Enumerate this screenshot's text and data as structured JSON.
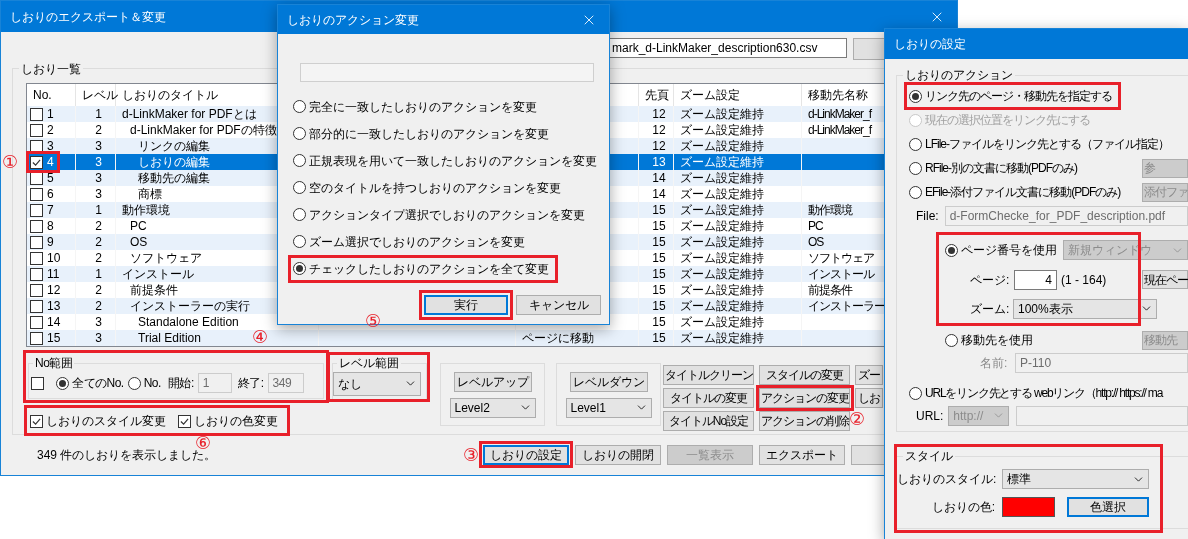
{
  "main_window": {
    "title": "しおりのエクスポート＆変更",
    "file_field": "mark_d-LinkMaker_description630.csv",
    "bookmark_list": {
      "title": "しおり一覧",
      "columns": [
        "No.",
        "レベル",
        "しおりのタイトル",
        "先頁",
        "ズーム設定",
        "移動先名称"
      ],
      "rows": [
        {
          "checked": false,
          "selected": false,
          "no": "1",
          "level": "1",
          "title": "d-LinkMaker for PDFとは",
          "page": "12",
          "zoom": "ズーム設定維持",
          "destination": "d-LinkMaker_f"
        },
        {
          "checked": false,
          "selected": false,
          "no": "2",
          "level": "2",
          "title": "d-LinkMaker for PDFの特徴",
          "page": "12",
          "zoom": "ズーム設定維持",
          "destination": "d-LinkMaker_f"
        },
        {
          "checked": false,
          "selected": false,
          "no": "3",
          "level": "3",
          "title": "リンクの編集",
          "page": "12",
          "zoom": "ズーム設定維持"
        },
        {
          "checked": true,
          "selected": true,
          "no": "4",
          "level": "3",
          "title": "しおりの編集",
          "page": "13",
          "zoom": "ズーム設定維持"
        },
        {
          "checked": false,
          "selected": false,
          "no": "5",
          "level": "3",
          "title": "移動先の編集",
          "page": "14",
          "zoom": "ズーム設定維持"
        },
        {
          "checked": false,
          "selected": false,
          "no": "6",
          "level": "3",
          "title": "商標",
          "page": "14",
          "zoom": "ズーム設定維持"
        },
        {
          "checked": false,
          "selected": false,
          "no": "7",
          "level": "1",
          "title": "動作環境",
          "page": "15",
          "zoom": "ズーム設定維持",
          "destination": "動作環境"
        },
        {
          "checked": false,
          "selected": false,
          "no": "8",
          "level": "2",
          "title": "PC",
          "page": "15",
          "zoom": "ズーム設定維持",
          "destination": "PC"
        },
        {
          "checked": false,
          "selected": false,
          "no": "9",
          "level": "2",
          "title": "OS",
          "page": "15",
          "zoom": "ズーム設定維持",
          "destination": "OS"
        },
        {
          "checked": false,
          "selected": false,
          "no": "10",
          "level": "2",
          "title": "ソフトウェア",
          "page": "15",
          "zoom": "ズーム設定維持",
          "destination": "ソフトウェア"
        },
        {
          "checked": false,
          "selected": false,
          "no": "11",
          "level": "1",
          "title": "インストール",
          "page": "15",
          "zoom": "ズーム設定維持",
          "destination": "インストール"
        },
        {
          "checked": false,
          "selected": false,
          "no": "12",
          "level": "2",
          "title": "前提条件",
          "page": "15",
          "zoom": "ズーム設定維持",
          "destination": "前提条件"
        },
        {
          "checked": false,
          "selected": false,
          "no": "13",
          "level": "2",
          "title": "インストーラーの実行",
          "page": "15",
          "zoom": "ズーム設定維持",
          "destination": "インストーラー"
        },
        {
          "checked": false,
          "selected": false,
          "no": "14",
          "level": "3",
          "title": "Standalone Edition",
          "page": "15",
          "zoom": "ズーム設定維持"
        },
        {
          "checked": false,
          "selected": false,
          "no": "15",
          "level": "3",
          "title": "Trial Edition",
          "action": "ページに移動",
          "page": "15",
          "zoom": "ズーム設定維持"
        }
      ]
    },
    "no_range": {
      "title": "No範囲",
      "checked": false,
      "options": [
        {
          "label": "全てのNo.",
          "selected": true
        },
        {
          "label": "No.",
          "selected": false
        }
      ],
      "start_label": "開始:",
      "start": "1",
      "end_label": "終了:",
      "end": "349"
    },
    "level_range": {
      "title": "レベル範囲",
      "value": "なし"
    },
    "level_up": {
      "button": "レベルアップ",
      "value": "Level2"
    },
    "level_down": {
      "button": "レベルダウン",
      "value": "Level1"
    },
    "edit_buttons": [
      "タイトルクリーン",
      "スタイルの変更",
      "ズー",
      "タイトルの変更",
      "アクションの変更",
      "しお",
      "タイトルNo設定",
      "アクションの削除"
    ],
    "options": [
      {
        "label": "しおりのスタイル変更",
        "checked": true
      },
      {
        "label": "しおりの色変更",
        "checked": true
      }
    ],
    "status": "349 件のしおりを表示しました。",
    "footer_buttons": [
      {
        "label": "しおりの設定",
        "default": true,
        "disabled": false
      },
      {
        "label": "しおりの開閉",
        "default": false,
        "disabled": false
      },
      {
        "label": "一覧表示",
        "default": false,
        "disabled": true
      },
      {
        "label": "エクスポート",
        "default": false,
        "disabled": false
      }
    ]
  },
  "action_dialog": {
    "title": "しおりのアクション変更",
    "options": [
      {
        "label": "完全に一致したしおりのアクションを変更",
        "selected": false
      },
      {
        "label": "部分的に一致したしおりのアクションを変更",
        "selected": false
      },
      {
        "label": "正規表現を用いて一致したしおりのアクションを変更",
        "selected": false
      },
      {
        "label": "空のタイトルを持つしおりのアクションを変更",
        "selected": false
      },
      {
        "label": "アクションタイプ選択でしおりのアクションを変更",
        "selected": false
      },
      {
        "label": "ズーム選択でしおりのアクションを変更",
        "selected": false
      },
      {
        "label": "チェックしたしおりのアクションを全て変更",
        "selected": true
      }
    ],
    "buttons": [
      {
        "label": "実行",
        "default": true
      },
      {
        "label": "キャンセル",
        "default": false
      }
    ]
  },
  "settings_dialog": {
    "title": "しおりの設定",
    "action_group": "しおりのアクション",
    "link_options": [
      {
        "label": "リンク先のページ・移動先を指定する",
        "selected": true,
        "disabled": false
      },
      {
        "label": "現在の選択位置をリンク先にする",
        "selected": false,
        "disabled": true
      },
      {
        "label": "LFile-ファイルをリンク先とする（ファイル指定）",
        "selected": false,
        "disabled": false
      },
      {
        "label": "RFile-別の文書に移動(PDFのみ)",
        "selected": false,
        "disabled": false,
        "button": "参"
      },
      {
        "label": "EFile-添付ファイル文書に移動(PDFのみ)",
        "selected": false,
        "disabled": false,
        "button": "添付ファ"
      }
    ],
    "file": {
      "label": "File:",
      "value": "d-FormChecke_for_PDF_description.pdf"
    },
    "page_number": {
      "label": "ページ番号を使用",
      "selected": true,
      "window": "新規ウィンドウ",
      "page_label": "ページ:",
      "page": "4",
      "range": "(1 - 164)",
      "current_button": "現在ペー",
      "zoom_label": "ズーム:",
      "zoom": "100%表示"
    },
    "destination": {
      "label": "移動先を使用",
      "selected": false,
      "button": "移動先",
      "name_label": "名前:",
      "name": "P-110"
    },
    "url": {
      "label": "URLをリンク先とする  webリンク（http://  https:// ma",
      "selected": false,
      "url_label": "URL:",
      "scheme": "http://"
    },
    "style": {
      "title": "スタイル",
      "style_label": "しおりのスタイル:",
      "style": "標準",
      "color_label": "しおりの色:",
      "color": "#ff0000",
      "button": "色選択"
    }
  },
  "annotations": [
    "①",
    "②",
    "③",
    "④",
    "⑤",
    "⑥"
  ]
}
